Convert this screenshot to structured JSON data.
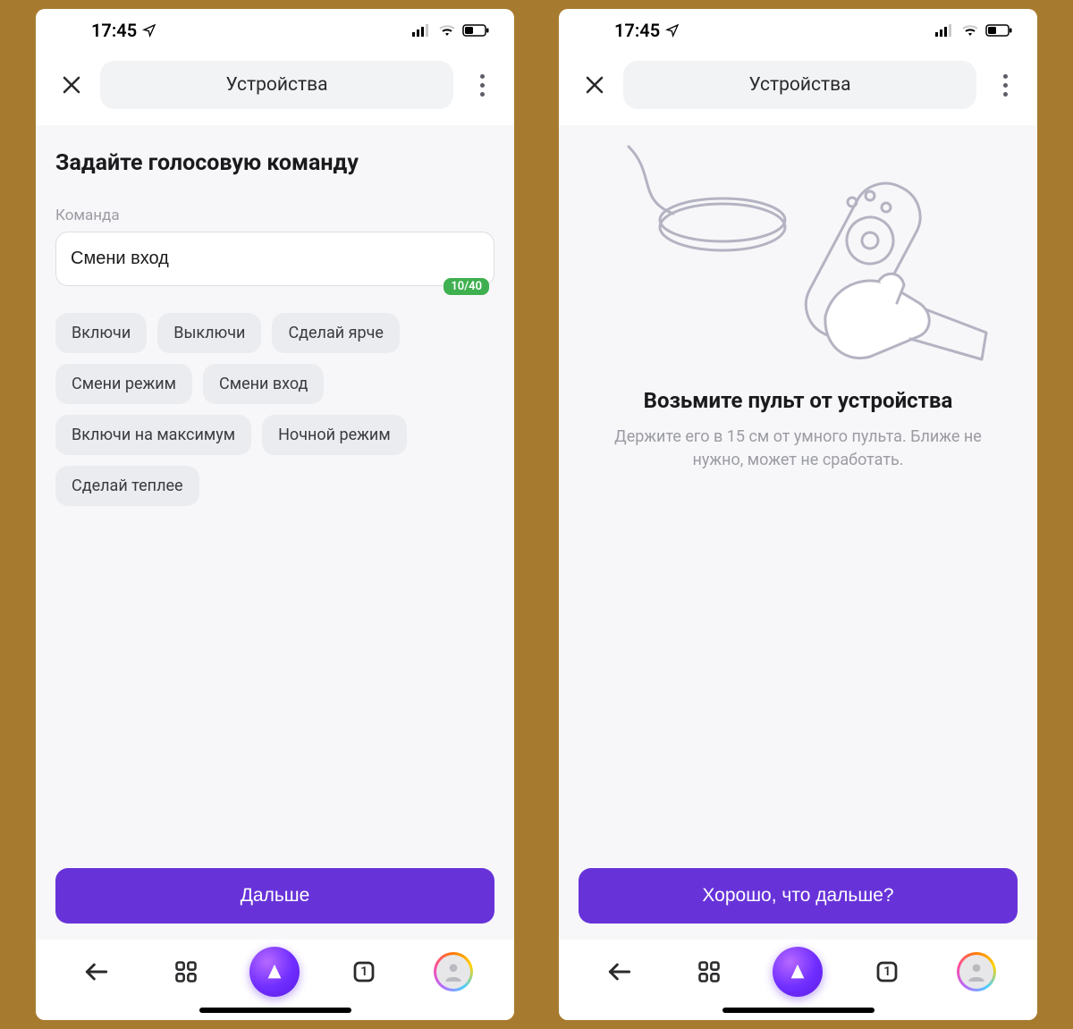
{
  "status": {
    "time": "17:45"
  },
  "header": {
    "title": "Устройства"
  },
  "left": {
    "title": "Задайте голосовую команду",
    "field_label": "Команда",
    "input_value": "Смени вход",
    "counter": "10/40",
    "chips": [
      "Включи",
      "Выключи",
      "Сделай ярче",
      "Смени режим",
      "Смени вход",
      "Включи на максимум",
      "Ночной режим",
      "Сделай теплее"
    ],
    "button": "Дальше"
  },
  "right": {
    "title": "Возьмите пульт от устройства",
    "subtitle": "Держите его в 15 см от умного пульта. Ближе не нужно, может не сработать.",
    "button": "Хорошо, что дальше?"
  },
  "nav": {
    "tab_count": "1"
  }
}
